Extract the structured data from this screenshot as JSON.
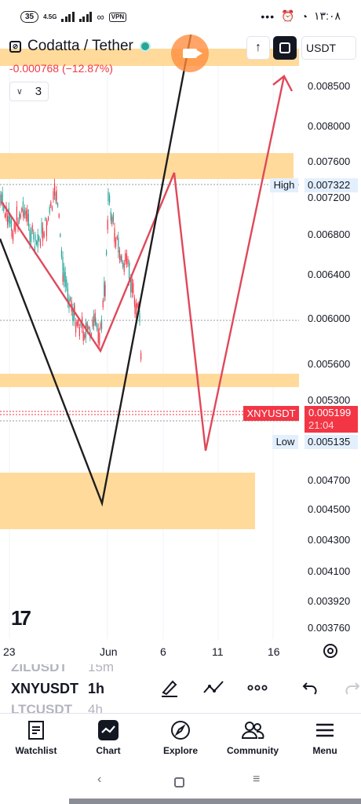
{
  "status_bar": {
    "notif_count": "35",
    "network": "4.5G",
    "vpn": "VPN",
    "dots": "•••",
    "clock": "١٣:٠٨"
  },
  "symbol": {
    "title": "Codatta / Tether",
    "change": "-0.000768 (−12.87%)",
    "indicators_count": "3",
    "currency": "USDT"
  },
  "price_axis": [
    "0.008500",
    "0.008000",
    "0.007600",
    "0.007200",
    "0.006800",
    "0.006400",
    "0.006000",
    "0.005600",
    "0.005300",
    "0.004700",
    "0.004500",
    "0.004300",
    "0.004100",
    "0.003920",
    "0.003760"
  ],
  "tags": {
    "high_label": "High",
    "high_value": "0.007322",
    "low_label": "Low",
    "low_value": "0.005135",
    "symbol_code": "XNYUSDT",
    "last_price": "0.005199",
    "countdown": "21:04"
  },
  "time_axis": [
    "23",
    "Jun",
    "6",
    "11",
    "16"
  ],
  "logo_text": "17",
  "picker": {
    "prev_symbol": "ZILUSDT",
    "prev_interval": "15m",
    "current_symbol": "XNYUSDT",
    "current_interval": "1h",
    "next_symbol": "LTCUSDT",
    "next_interval": "4h"
  },
  "nav": [
    {
      "label": "Watchlist",
      "icon": "watchlist-icon"
    },
    {
      "label": "Chart",
      "icon": "chart-icon"
    },
    {
      "label": "Explore",
      "icon": "compass-icon"
    },
    {
      "label": "Community",
      "icon": "community-icon"
    },
    {
      "label": "Menu",
      "icon": "hamburger-icon"
    }
  ],
  "colors": {
    "zone": "#ffd48a",
    "bear": "#f23645",
    "bull": "#26a69a",
    "drawing_red": "#e0485a",
    "drawing_black": "#1e1e1e"
  }
}
